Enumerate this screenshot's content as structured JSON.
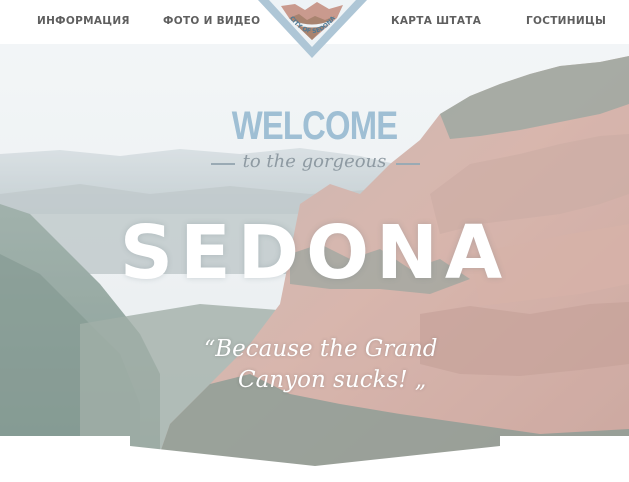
{
  "nav": {
    "items": [
      {
        "label": "ИНФОРМАЦИЯ"
      },
      {
        "label": "ФОТО И ВИДЕО"
      },
      {
        "label": "КАРТА ШТАТА"
      },
      {
        "label": "ГОСТИНИЦЫ"
      }
    ]
  },
  "emblem": {
    "text_top": "ARIZONA",
    "text_bottom": "CITY OF SEDONA"
  },
  "hero": {
    "welcome": "WELCOME",
    "tagline": "to the gorgeous",
    "title": "SEDONA",
    "quote_line1": "Because the Grand",
    "quote_line2": "Canyon sucks!",
    "quote_open": "“",
    "quote_close": "„"
  },
  "colors": {
    "nav_text": "#5f5f5f",
    "welcome": "#9fbfd4",
    "sky": "#e6ecf0",
    "rock": "#c99a8e",
    "forest": "#5d7a70"
  }
}
